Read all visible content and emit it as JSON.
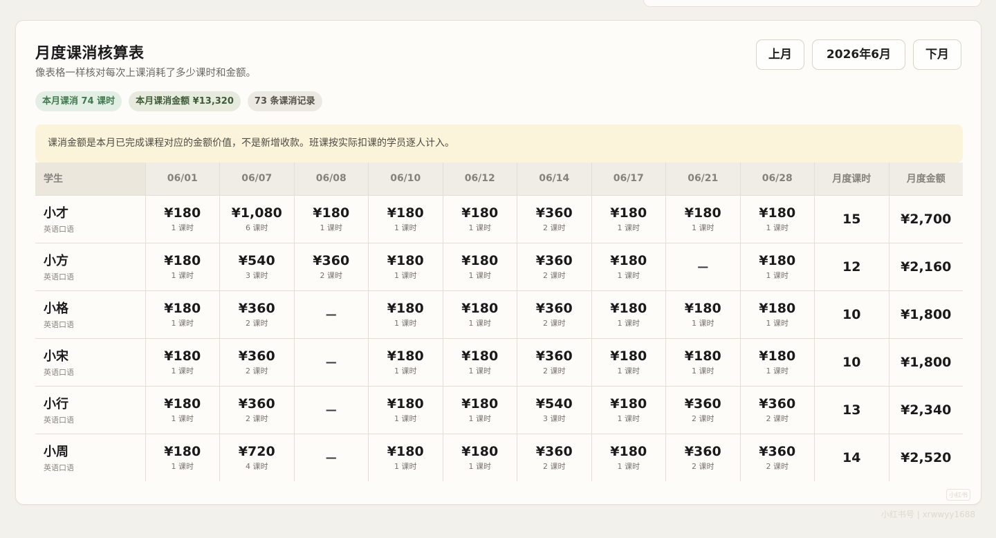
{
  "header": {
    "title": "月度课消核算表",
    "subtitle": "像表格一样核对每次上课消耗了多少课时和金额。",
    "prev_label": "上月",
    "month_label": "2026年6月",
    "next_label": "下月"
  },
  "chips": [
    {
      "label": "本月课消 74 课时",
      "color": "#3f7a4c"
    },
    {
      "label": "本月课消金额 ¥13,320",
      "color": "#3e5b38"
    },
    {
      "label": "73 条课消记录",
      "color": "#55524b"
    }
  ],
  "notice": "课消金额是本月已完成课程对应的金额价值，不是新增收款。班课按实际扣课的学员逐人计入。",
  "table": {
    "headers": [
      "学生",
      "06/01",
      "06/07",
      "06/08",
      "06/10",
      "06/12",
      "06/14",
      "06/17",
      "06/21",
      "06/28",
      "月度课时",
      "月度金额"
    ],
    "rows": [
      {
        "name": "小才",
        "course": "英语口语",
        "cells": [
          {
            "amount": "¥180",
            "hours": "1 课时"
          },
          {
            "amount": "¥1,080",
            "hours": "6 课时"
          },
          {
            "amount": "¥180",
            "hours": "1 课时"
          },
          {
            "amount": "¥180",
            "hours": "1 课时"
          },
          {
            "amount": "¥180",
            "hours": "1 课时"
          },
          {
            "amount": "¥360",
            "hours": "2 课时"
          },
          {
            "amount": "¥180",
            "hours": "1 课时"
          },
          {
            "amount": "¥180",
            "hours": "1 课时"
          },
          {
            "amount": "¥180",
            "hours": "1 课时"
          }
        ],
        "total_hours": "15",
        "total_amount": "¥2,700"
      },
      {
        "name": "小方",
        "course": "英语口语",
        "cells": [
          {
            "amount": "¥180",
            "hours": "1 课时"
          },
          {
            "amount": "¥540",
            "hours": "3 课时"
          },
          {
            "amount": "¥360",
            "hours": "2 课时"
          },
          {
            "amount": "¥180",
            "hours": "1 课时"
          },
          {
            "amount": "¥180",
            "hours": "1 课时"
          },
          {
            "amount": "¥360",
            "hours": "2 课时"
          },
          {
            "amount": "¥180",
            "hours": "1 课时"
          },
          {
            "amount": "—",
            "hours": ""
          },
          {
            "amount": "¥180",
            "hours": "1 课时"
          }
        ],
        "total_hours": "12",
        "total_amount": "¥2,160"
      },
      {
        "name": "小格",
        "course": "英语口语",
        "cells": [
          {
            "amount": "¥180",
            "hours": "1 课时"
          },
          {
            "amount": "¥360",
            "hours": "2 课时"
          },
          {
            "amount": "—",
            "hours": ""
          },
          {
            "amount": "¥180",
            "hours": "1 课时"
          },
          {
            "amount": "¥180",
            "hours": "1 课时"
          },
          {
            "amount": "¥360",
            "hours": "2 课时"
          },
          {
            "amount": "¥180",
            "hours": "1 课时"
          },
          {
            "amount": "¥180",
            "hours": "1 课时"
          },
          {
            "amount": "¥180",
            "hours": "1 课时"
          }
        ],
        "total_hours": "10",
        "total_amount": "¥1,800"
      },
      {
        "name": "小宋",
        "course": "英语口语",
        "cells": [
          {
            "amount": "¥180",
            "hours": "1 课时"
          },
          {
            "amount": "¥360",
            "hours": "2 课时"
          },
          {
            "amount": "—",
            "hours": ""
          },
          {
            "amount": "¥180",
            "hours": "1 课时"
          },
          {
            "amount": "¥180",
            "hours": "1 课时"
          },
          {
            "amount": "¥360",
            "hours": "2 课时"
          },
          {
            "amount": "¥180",
            "hours": "1 课时"
          },
          {
            "amount": "¥180",
            "hours": "1 课时"
          },
          {
            "amount": "¥180",
            "hours": "1 课时"
          }
        ],
        "total_hours": "10",
        "total_amount": "¥1,800"
      },
      {
        "name": "小行",
        "course": "英语口语",
        "cells": [
          {
            "amount": "¥180",
            "hours": "1 课时"
          },
          {
            "amount": "¥360",
            "hours": "2 课时"
          },
          {
            "amount": "—",
            "hours": ""
          },
          {
            "amount": "¥180",
            "hours": "1 课时"
          },
          {
            "amount": "¥180",
            "hours": "1 课时"
          },
          {
            "amount": "¥540",
            "hours": "3 课时"
          },
          {
            "amount": "¥180",
            "hours": "1 课时"
          },
          {
            "amount": "¥360",
            "hours": "2 课时"
          },
          {
            "amount": "¥360",
            "hours": "2 课时"
          }
        ],
        "total_hours": "13",
        "total_amount": "¥2,340"
      },
      {
        "name": "小周",
        "course": "英语口语",
        "cells": [
          {
            "amount": "¥180",
            "hours": "1 课时"
          },
          {
            "amount": "¥720",
            "hours": "4 课时"
          },
          {
            "amount": "—",
            "hours": ""
          },
          {
            "amount": "¥180",
            "hours": "1 课时"
          },
          {
            "amount": "¥180",
            "hours": "1 课时"
          },
          {
            "amount": "¥360",
            "hours": "2 课时"
          },
          {
            "amount": "¥180",
            "hours": "1 课时"
          },
          {
            "amount": "¥360",
            "hours": "2 课时"
          },
          {
            "amount": "¥360",
            "hours": "2 课时"
          }
        ],
        "total_hours": "14",
        "total_amount": "¥2,520"
      }
    ]
  },
  "watermark": {
    "logo": "小红书",
    "text": "小红书号 | xrwwyy1688"
  }
}
